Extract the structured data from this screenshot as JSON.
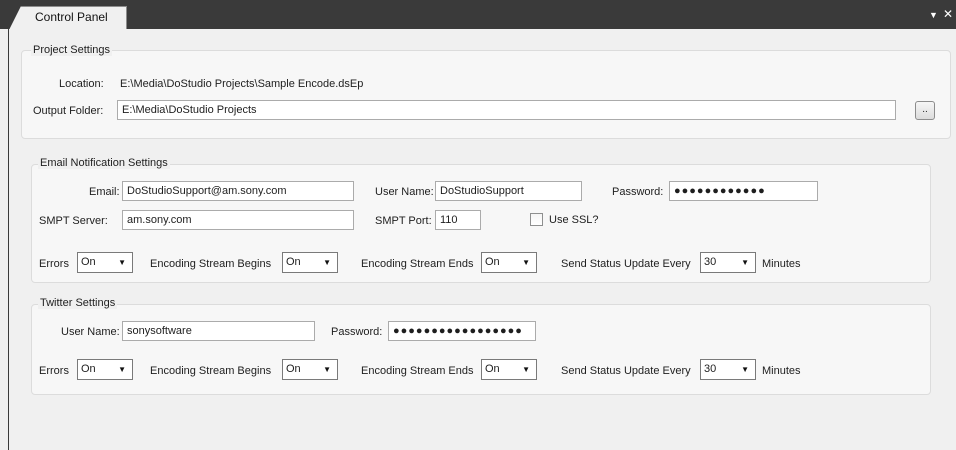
{
  "window": {
    "tab_title": "Control Panel",
    "menu_icon": "dropdown-arrow-icon",
    "close_icon": "close-icon"
  },
  "project_settings": {
    "title": "Project Settings",
    "location_label": "Location:",
    "location_value": "E:\\Media\\DoStudio Projects\\Sample Encode.dsEp",
    "output_folder_label": "Output Folder:",
    "output_folder_value": "E:\\Media\\DoStudio Projects",
    "browse_label": ".."
  },
  "email_settings": {
    "title": "Email Notification Settings",
    "email_label": "Email:",
    "email_value": "DoStudioSupport@am.sony.com",
    "username_label": "User Name:",
    "username_value": "DoStudioSupport",
    "password_label": "Password:",
    "password_value": "●●●●●●●●●●●●",
    "smtp_server_label": "SMPT Server:",
    "smtp_server_value": "am.sony.com",
    "smtp_port_label": "SMPT Port:",
    "smtp_port_value": "110",
    "use_ssl_label": "Use SSL?",
    "use_ssl_checked": false,
    "errors_label": "Errors",
    "errors_value": "On",
    "stream_begins_label": "Encoding Stream Begins",
    "stream_begins_value": "On",
    "stream_ends_label": "Encoding Stream Ends",
    "stream_ends_value": "On",
    "status_update_label": "Send Status Update Every",
    "status_update_value": "30",
    "minutes_label": "Minutes"
  },
  "twitter_settings": {
    "title": "Twitter Settings",
    "username_label": "User Name:",
    "username_value": "sonysoftware",
    "password_label": "Password:",
    "password_value": "●●●●●●●●●●●●●●●●●",
    "errors_label": "Errors",
    "errors_value": "On",
    "stream_begins_label": "Encoding Stream Begins",
    "stream_begins_value": "On",
    "stream_ends_label": "Encoding Stream Ends",
    "stream_ends_value": "On",
    "status_update_label": "Send Status Update Every",
    "status_update_value": "30",
    "minutes_label": "Minutes"
  }
}
